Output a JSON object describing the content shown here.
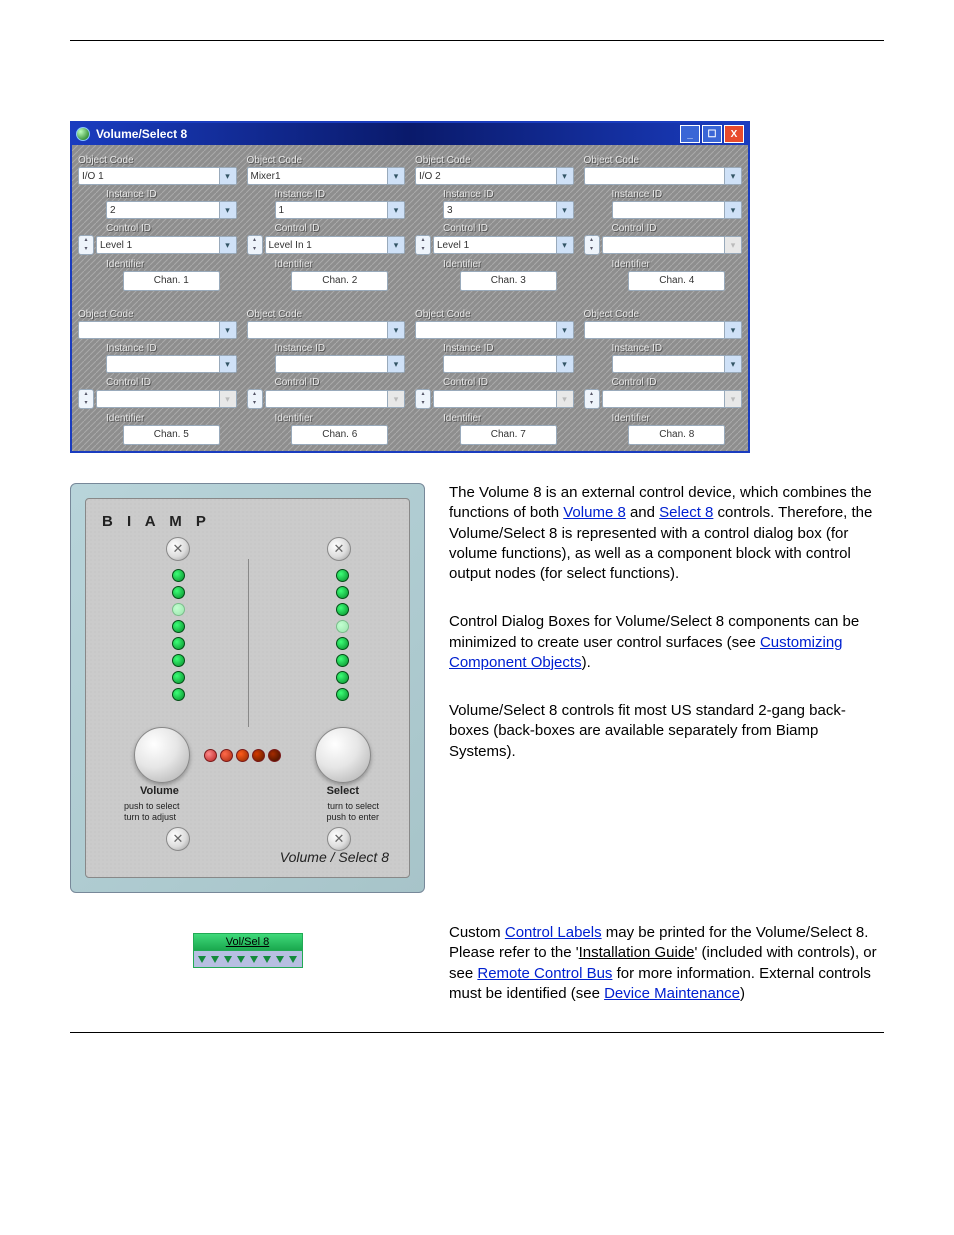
{
  "dialog": {
    "title": "Volume/Select 8",
    "labels": {
      "object_code": "Object Code",
      "instance_id": "Instance ID",
      "control_id": "Control ID",
      "identifier": "Identifier"
    },
    "columns_top": [
      {
        "object_code": "I/O 1",
        "instance_id": "2",
        "control_id": "Level 1",
        "identifier": "Chan. 1",
        "enabled": true
      },
      {
        "object_code": "Mixer1",
        "instance_id": "1",
        "control_id": "Level In 1",
        "identifier": "Chan. 2",
        "enabled": true
      },
      {
        "object_code": "I/O 2",
        "instance_id": "3",
        "control_id": "Level 1",
        "identifier": "Chan. 3",
        "enabled": true
      },
      {
        "object_code": "",
        "instance_id": "",
        "control_id": "",
        "identifier": "Chan. 4",
        "enabled": false
      }
    ],
    "columns_bottom": [
      {
        "object_code": "",
        "instance_id": "",
        "control_id": "",
        "identifier": "Chan. 5",
        "enabled": false
      },
      {
        "object_code": "",
        "instance_id": "",
        "control_id": "",
        "identifier": "Chan. 6",
        "enabled": false
      },
      {
        "object_code": "",
        "instance_id": "",
        "control_id": "",
        "identifier": "Chan. 7",
        "enabled": false
      },
      {
        "object_code": "",
        "instance_id": "",
        "control_id": "",
        "identifier": "Chan. 8",
        "enabled": false
      }
    ]
  },
  "device": {
    "brand": "B I A M P",
    "volume_label": "Volume",
    "select_label": "Select",
    "volume_sub": "push to select\nturn to adjust",
    "select_sub": "turn to select\npush to enter",
    "title": "Volume / Select 8"
  },
  "text": {
    "p1a": "The Volume 8 is an external control device, which combines the functions of both ",
    "link_volume8": "Volume 8",
    "p1b": " and ",
    "link_select8": "Select 8",
    "p1c": " controls. Therefore, the Volume/Select 8 is represented with a control dialog box (for volume functions), as well as a component block with control output nodes (for select functions).",
    "p2a": "Control Dialog Boxes for Volume/Select 8 components can be minimized to create user control surfaces (see ",
    "link_custom": "Customizing Component Objects",
    "p2b": ").",
    "p3": "Volume/Select 8 controls fit most US standard 2-gang back-boxes (back-boxes are available separately from Biamp Systems).",
    "p4a": "Custom ",
    "link_labels": "Control Labels",
    "p4b": " may be printed for the Volume/Select 8. Please refer to the '",
    "install_guide": "Installation Guide",
    "p4c": "' (included with controls), or see ",
    "link_rcb": "Remote Control Bus",
    "p4d": " for more information. External controls must be identified (see ",
    "link_devmaint": "Device Maintenance",
    "p4e": ")"
  },
  "block": {
    "label": "Vol/Sel 8"
  }
}
